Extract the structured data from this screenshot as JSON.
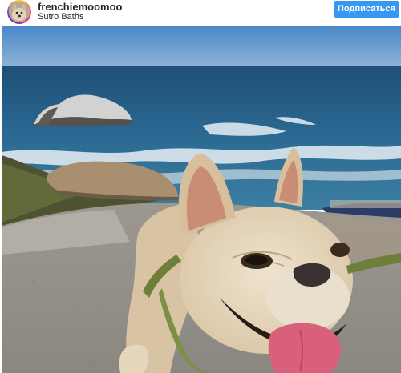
{
  "post": {
    "username": "frenchiemoomoo",
    "location": "Sutro Baths",
    "subscribe_label": "Подписаться"
  },
  "colors": {
    "accent": "#3897f0",
    "text": "#262626"
  },
  "icons": {
    "avatar": "dog-avatar-icon"
  },
  "photo": {
    "subject": "french-bulldog-photo"
  }
}
